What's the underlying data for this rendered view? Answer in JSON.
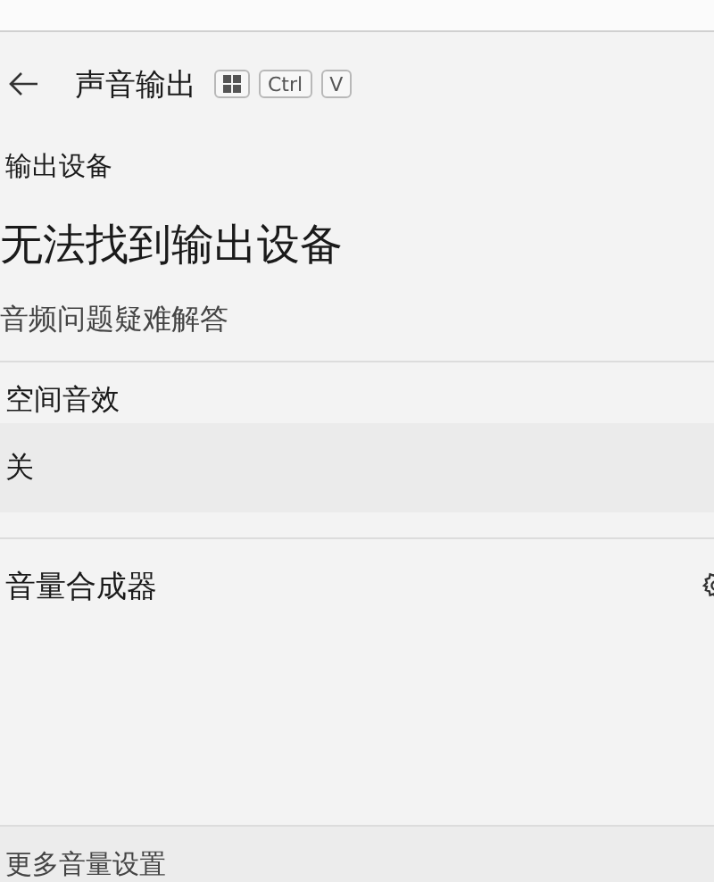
{
  "header": {
    "title": "声音输出",
    "shortcut_keys": [
      {
        "kind": "logo"
      },
      {
        "kind": "text",
        "label": "Ctrl"
      },
      {
        "kind": "text",
        "label": "V"
      }
    ]
  },
  "section_title": "输出设备",
  "status_message": "无法找到输出设备",
  "troubleshoot_link": "音频问题疑难解答",
  "spatial_sound": {
    "label": "空间音效",
    "value": "关"
  },
  "volume_mixer": {
    "label": "音量合成器"
  },
  "more_settings": "更多音量设置"
}
